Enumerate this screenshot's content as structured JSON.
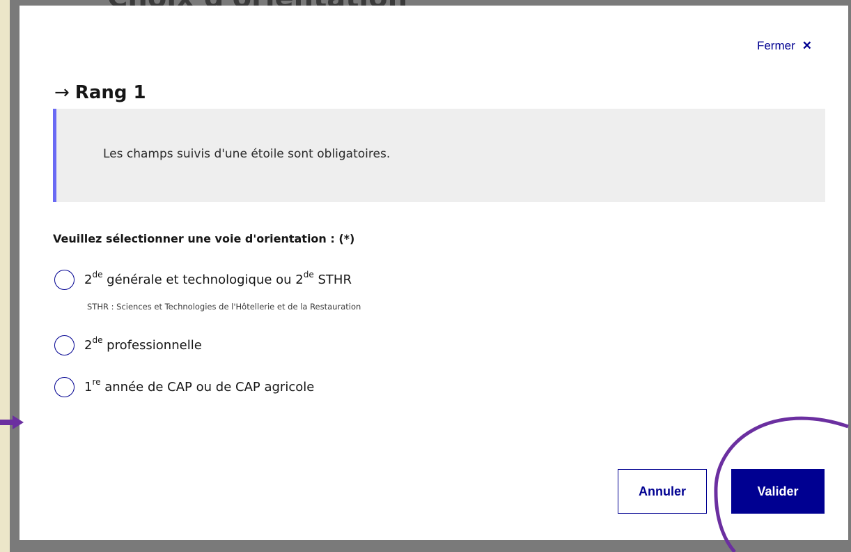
{
  "background": {
    "heading": "Choix d'orientation"
  },
  "modal": {
    "close_label": "Fermer",
    "close_icon": "close-icon",
    "title_arrow": "→",
    "title": "Rang 1",
    "callout_text": "Les champs suivis d'une étoile sont obligatoires.",
    "legend": "Veuillez sélectionner une voie d'orientation : (*)",
    "options": [
      {
        "parts": [
          "2",
          "de",
          " générale et technologique ou 2",
          "de",
          " STHR"
        ],
        "hint": "STHR : Sciences et Technologies de l'Hôtellerie et de la Restauration",
        "selected": false
      },
      {
        "parts": [
          "2",
          "de",
          " professionnelle"
        ],
        "selected": false
      },
      {
        "parts": [
          "1",
          "re",
          " année de CAP ou de CAP agricole"
        ],
        "selected": false
      }
    ],
    "cancel_label": "Annuler",
    "validate_label": "Valider"
  },
  "colors": {
    "primary": "#000091",
    "callout_border": "#6a6af4",
    "annotation": "#6b2fa0"
  }
}
